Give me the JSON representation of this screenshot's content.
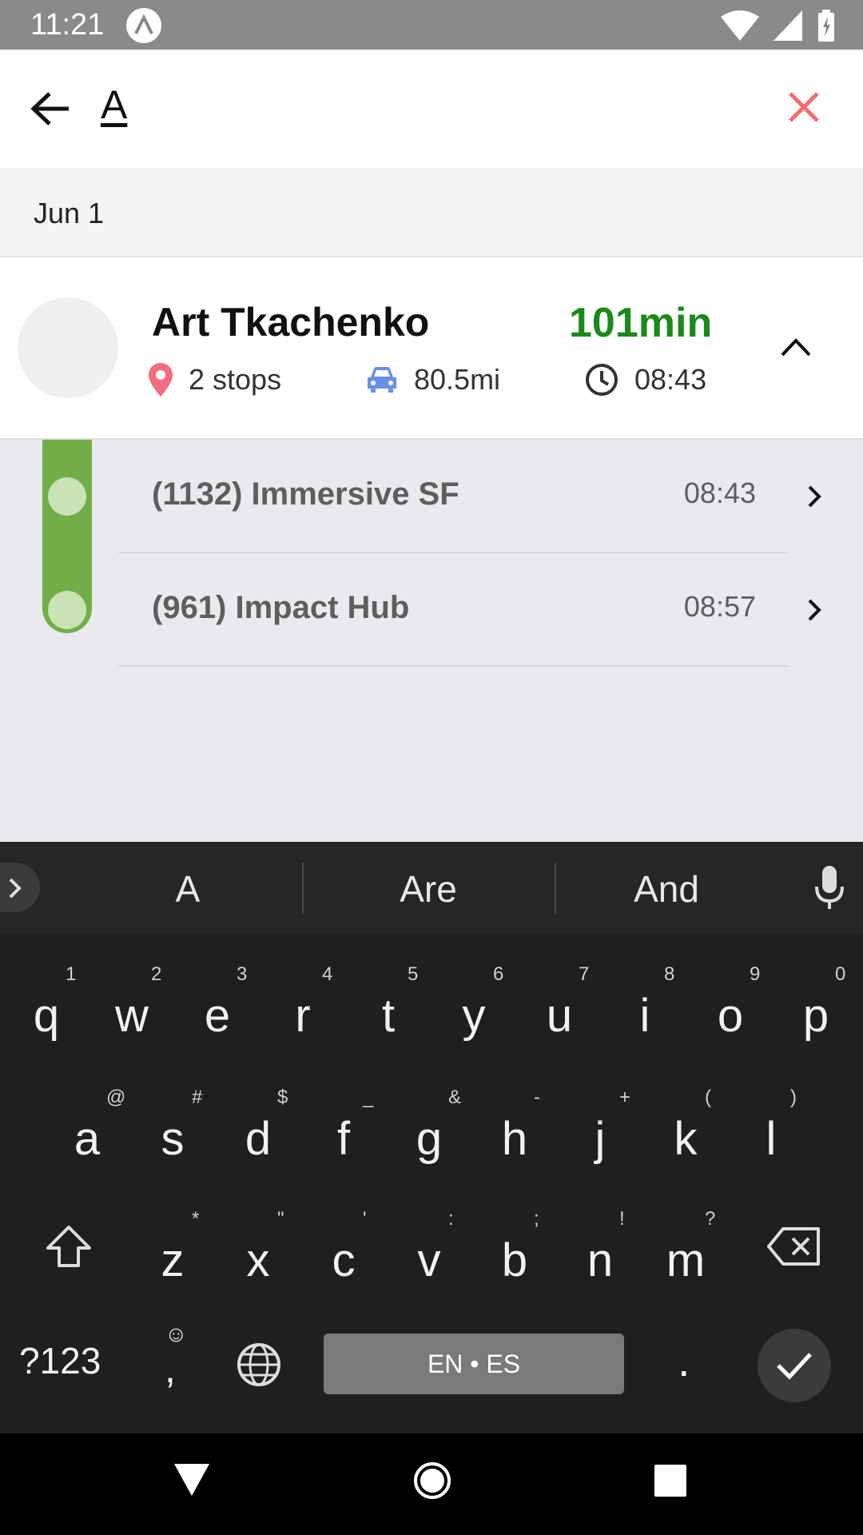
{
  "status_bar": {
    "time": "11:21"
  },
  "search": {
    "query": "A"
  },
  "section": {
    "date": "Jun 1"
  },
  "route": {
    "driver": "Art Tkachenko",
    "duration": "101min",
    "stops": "2 stops",
    "distance": "80.5mi",
    "start_time": "08:43",
    "colors": {
      "duration": "#1a8a1a",
      "pin": "#f26d7d",
      "car": "#6a8fe6",
      "rail": "#72ae47"
    }
  },
  "stops": [
    {
      "name": "(1132) Immersive SF",
      "eta": "08:43"
    },
    {
      "name": "(961) Impact Hub",
      "eta": "08:57"
    }
  ],
  "keyboard": {
    "suggestions": [
      "A",
      "Are",
      "And"
    ],
    "row1": [
      {
        "k": "q",
        "h": "1"
      },
      {
        "k": "w",
        "h": "2"
      },
      {
        "k": "e",
        "h": "3"
      },
      {
        "k": "r",
        "h": "4"
      },
      {
        "k": "t",
        "h": "5"
      },
      {
        "k": "y",
        "h": "6"
      },
      {
        "k": "u",
        "h": "7"
      },
      {
        "k": "i",
        "h": "8"
      },
      {
        "k": "o",
        "h": "9"
      },
      {
        "k": "p",
        "h": "0"
      }
    ],
    "row2": [
      {
        "k": "a",
        "h": "@"
      },
      {
        "k": "s",
        "h": "#"
      },
      {
        "k": "d",
        "h": "$"
      },
      {
        "k": "f",
        "h": "_"
      },
      {
        "k": "g",
        "h": "&"
      },
      {
        "k": "h",
        "h": "-"
      },
      {
        "k": "j",
        "h": "+"
      },
      {
        "k": "k",
        "h": "("
      },
      {
        "k": "l",
        "h": ")"
      }
    ],
    "row3": [
      {
        "k": "z",
        "h": "*"
      },
      {
        "k": "x",
        "h": "\""
      },
      {
        "k": "c",
        "h": "'"
      },
      {
        "k": "v",
        "h": ":"
      },
      {
        "k": "b",
        "h": ";"
      },
      {
        "k": "n",
        "h": "!"
      },
      {
        "k": "m",
        "h": "?"
      }
    ],
    "symbols_key": "?123",
    "comma_key": ",",
    "period_key": ".",
    "space_label": "EN • ES"
  }
}
